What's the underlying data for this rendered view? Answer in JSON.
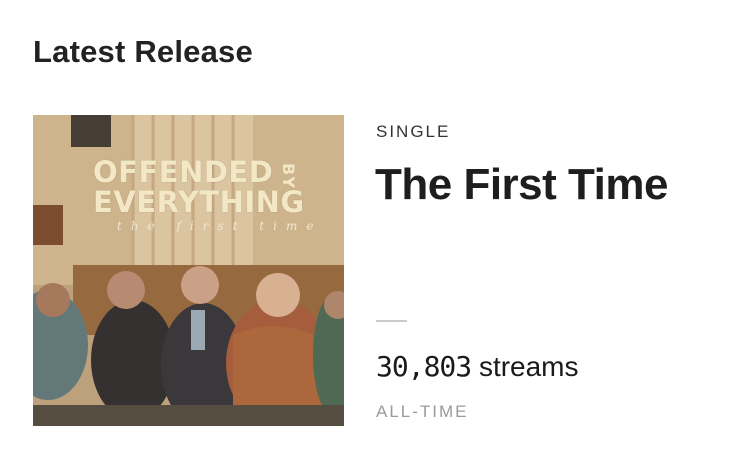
{
  "section": {
    "title": "Latest Release"
  },
  "release": {
    "type": "SINGLE",
    "title": "The First Time",
    "streams_count": "30,803",
    "streams_label": "streams",
    "period": "ALL-TIME"
  },
  "cover": {
    "band_line1": "OFFENDED",
    "band_line2": "EVERYTHING",
    "band_by": "BY",
    "subtitle": "the first time",
    "text_color": "#f3e8c6"
  }
}
